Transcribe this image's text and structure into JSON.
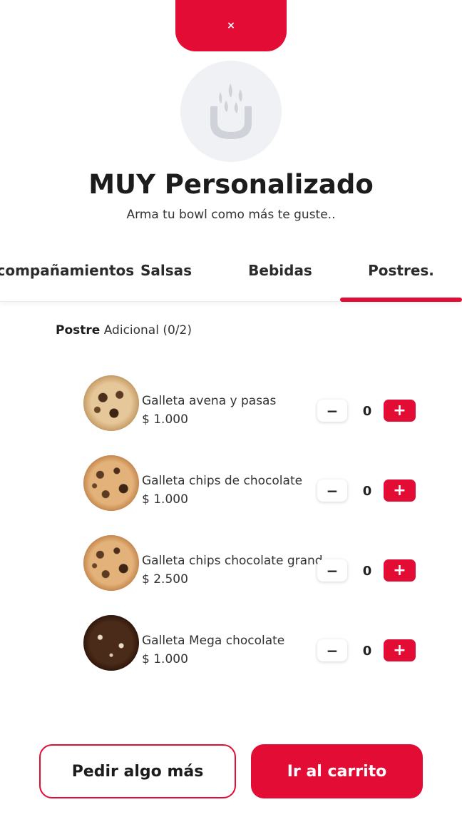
{
  "close_button": {
    "label": "×"
  },
  "header": {
    "title": "MUY Personalizado",
    "subtitle": "Arma tu bowl como más te guste.."
  },
  "tabs": [
    {
      "label": "Acompañamientos",
      "active": false
    },
    {
      "label": "Salsas",
      "active": false
    },
    {
      "label": "Bebidas",
      "active": false
    },
    {
      "label": "Postres.",
      "active": true
    }
  ],
  "section": {
    "label_strong": "Postre",
    "label_rest": "Adicional (0/2)"
  },
  "items": [
    {
      "name": "Galleta avena y pasas",
      "price": "$ 1.000",
      "quantity": "0",
      "minus_label": "−",
      "plus_label": "+"
    },
    {
      "name": "Galleta chips de chocolate",
      "price": "$ 1.000",
      "quantity": "0",
      "minus_label": "−",
      "plus_label": "+"
    },
    {
      "name": "Galleta chips chocolate grande",
      "price": "$ 2.500",
      "quantity": "0",
      "minus_label": "−",
      "plus_label": "+"
    },
    {
      "name": "Galleta Mega chocolate",
      "price": "$ 1.000",
      "quantity": "0",
      "minus_label": "−",
      "plus_label": "+"
    }
  ],
  "footer": {
    "secondary_label": "Pedir algo más",
    "primary_label": "Ir al carrito"
  },
  "colors": {
    "accent": "#e20c35",
    "logo_bg": "#f0f1f5"
  }
}
